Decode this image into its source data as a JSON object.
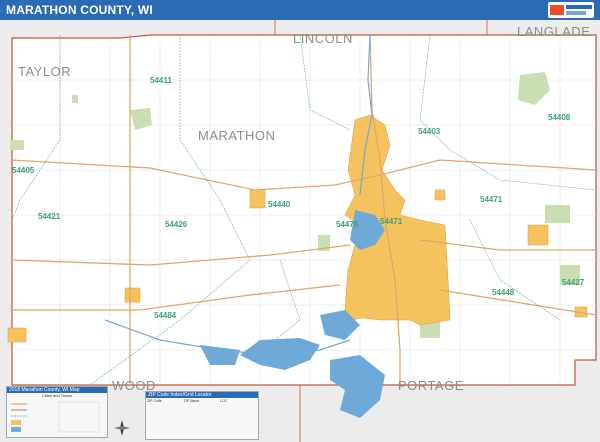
{
  "header": {
    "title": "MARATHON COUNTY, WI"
  },
  "neighbors": {
    "north": "LINCOLN",
    "northeast": "LANGLADE",
    "northwest": "TAYLOR",
    "south_left": "WOOD",
    "south_right": "PORTAGE"
  },
  "county_label": "MARATHON",
  "zip_labels": [
    "54411",
    "54403",
    "54408",
    "54405",
    "54471",
    "54421",
    "54426",
    "54448",
    "54427",
    "54476",
    "54484",
    "54440",
    "54471"
  ],
  "legend": {
    "title": "2018 Marathon County, WI Map",
    "subtitle": "Cities and Towns"
  },
  "zip_table": {
    "title": "ZIP Code Index/Grid Locator",
    "headers": [
      "ZIP Code",
      "ZIP Name",
      "LOC"
    ]
  },
  "colors": {
    "header": "#2a6bb4",
    "urban": "#f6c25e",
    "water": "#6fa9d8",
    "park": "#c9dfb1",
    "neighbor": "#ececec",
    "county_boundary": "#b85a3a",
    "road": "#e3a56a",
    "zip_boundary": "#5cb28f",
    "grid": "#cfcfcf"
  }
}
